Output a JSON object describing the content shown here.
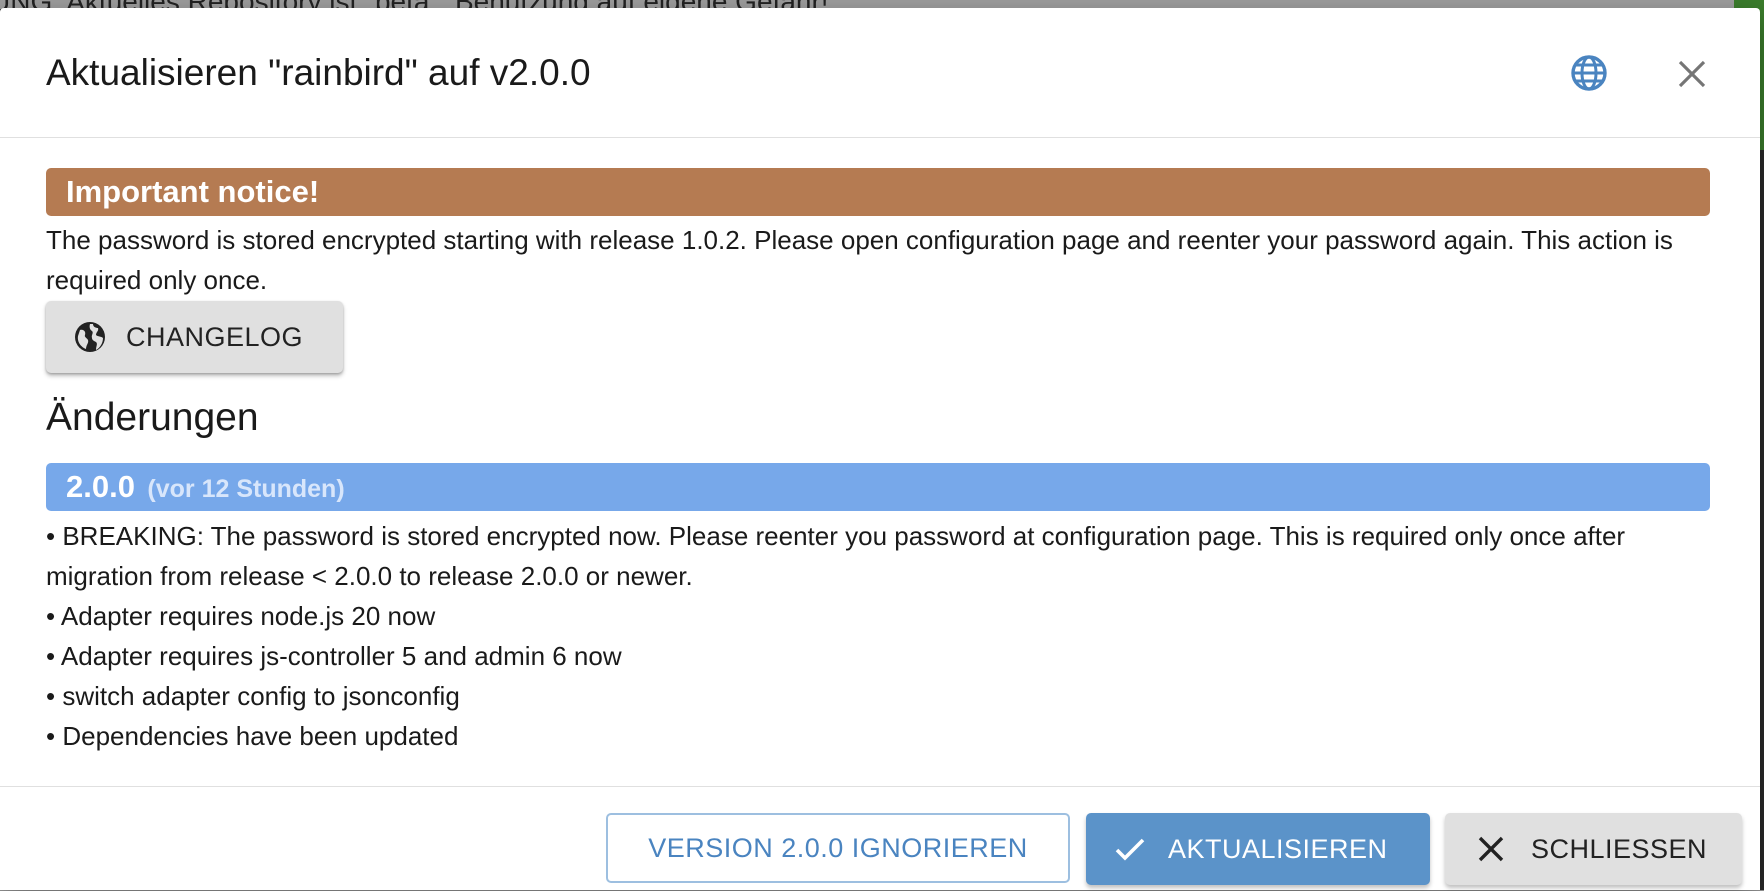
{
  "background": {
    "warning_text": "UNG: Aktuelles Repository ist \"beta\". Benutzung auf eigene Gefahr!"
  },
  "dialog": {
    "title": "Aktualisieren \"rainbird\" auf v2.0.0",
    "header_icons": [
      "globe-icon",
      "close-icon"
    ]
  },
  "notice": {
    "heading": "Important notice!",
    "text": "The password is stored encrypted starting with release 1.0.2. Please open configuration page and reenter your password again. This action is required only once.",
    "color": "#b57b52"
  },
  "changelog_button": {
    "label": "CHANGELOG",
    "icon": "public-globe-icon"
  },
  "changes": {
    "section_title": "Änderungen",
    "version": "2.0.0",
    "age": "(vor 12 Stunden)",
    "version_bar_color": "#77a8ea",
    "items": [
      "• BREAKING: The password is stored encrypted now. Please reenter you password at configuration page. This is required only once after migration from release < 2.0.0 to release 2.0.0 or newer.",
      "• Adapter requires node.js 20 now",
      "• Adapter requires js-controller 5 and admin 6 now",
      "• switch adapter config to jsonconfig",
      "• Dependencies have been updated"
    ]
  },
  "footer": {
    "ignore_label": "VERSION 2.0.0 IGNORIEREN",
    "update_label": "AKTUALISIEREN",
    "close_label": "SCHLIESSEN",
    "accent_color": "#5b93c9"
  }
}
